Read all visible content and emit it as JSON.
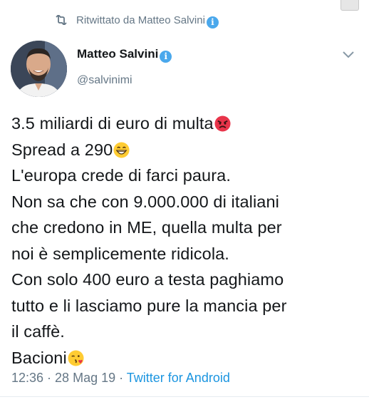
{
  "retweet": {
    "label": "Ritwittato da Matteo Salvini",
    "icon": "retweet-icon"
  },
  "author": {
    "name": "Matteo Salvini",
    "handle": "@salvinimi",
    "verified_icon": "verified-badge-icon",
    "avatar_icon": "profile-photo"
  },
  "tweet": {
    "lines": [
      "3.5 miliardi di euro di multa",
      "Spread a 290",
      "L'europa crede di farci paura.",
      "Non sa che con 9.000.000 di italiani",
      "che credono in ME, quella multa per",
      "noi è semplicemente ridicola.",
      "Con solo 400 euro a testa paghiamo",
      "tutto e li lasciamo pure la mancia per",
      "il caffè.",
      "Bacioni"
    ],
    "emoji": {
      "angry": "angry-face-emoji",
      "grin": "grinning-face-emoji",
      "kiss": "face-blowing-kiss-emoji"
    }
  },
  "meta": {
    "time": "12:36",
    "sep1": " · ",
    "date": "28 Mag 19",
    "sep2": " · ",
    "source": "Twitter for Android"
  },
  "colors": {
    "text": "#14171a",
    "secondary": "#657786",
    "link": "#1b95e0",
    "verified": "#4aa8ec"
  }
}
